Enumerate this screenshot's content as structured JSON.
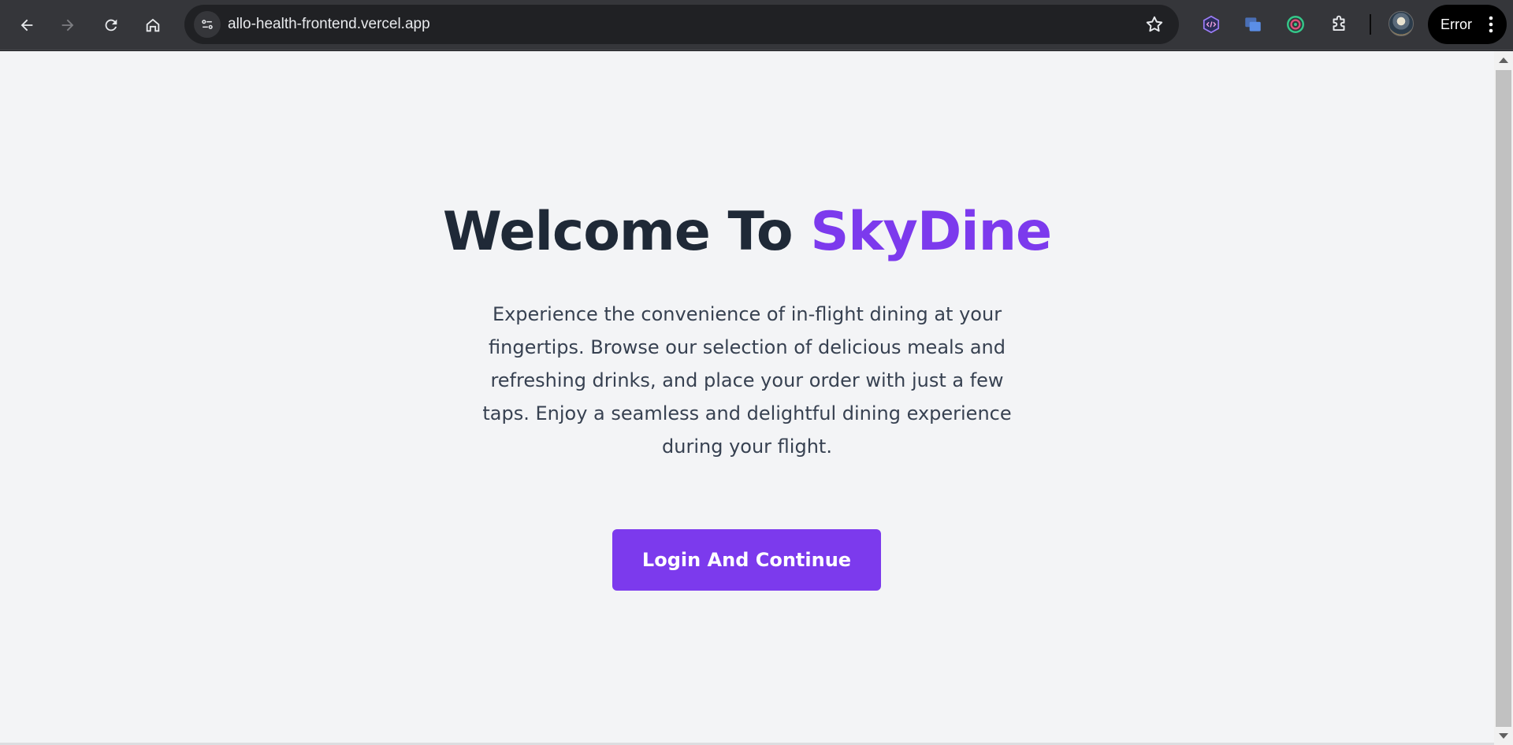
{
  "browser": {
    "url": "allo-health-frontend.vercel.app",
    "profile_status": "Error",
    "extensions": [
      "code-extension-icon",
      "window-extension-icon",
      "target-extension-icon",
      "puzzle-extensions-icon"
    ]
  },
  "hero": {
    "title_prefix": "Welcome To ",
    "title_brand": "SkyDine",
    "description": "Experience the convenience of in-flight dining at your fingertips. Browse our selection of delicious meals and refreshing drinks, and place your order with just a few taps. Enjoy a seamless and delightful dining experience during your flight.",
    "cta_label": "Login And Continue"
  },
  "colors": {
    "brand": "#7c3aed",
    "heading": "#1f2937",
    "body_text": "#374151",
    "page_background": "#f3f4f6"
  }
}
